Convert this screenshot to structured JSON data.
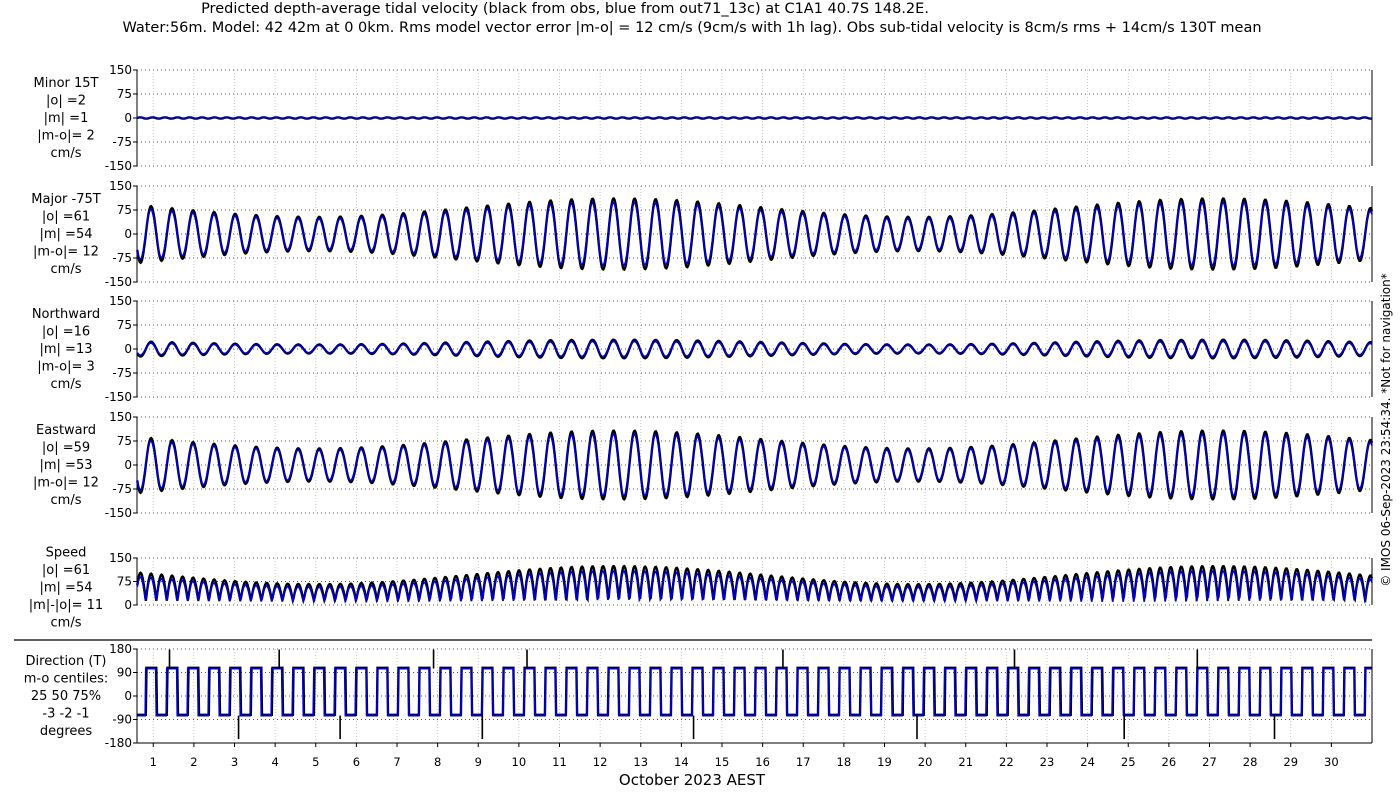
{
  "title": {
    "line1": "Predicted depth-average tidal velocity (black from obs, blue from out71_13c) at C1A1 40.7S 148.2E.",
    "line2": "Water:56m. Model: 42 42m at 0 0km. Rms model vector error |m-o| = 12 cm/s (9cm/s with 1h lag). Obs sub-tidal velocity is 8cm/s rms + 14cm/s 130T mean"
  },
  "side_note": "© IMOS 06-Sep-2023 23:54:34. *Not for navigation*",
  "colors": {
    "obs": "#000000",
    "model": "#0000cc",
    "grid": "#bdbdbd"
  },
  "chart_data": {
    "type": "line",
    "xlabel": "October 2023 AEST",
    "x_ticks": [
      "1",
      "2",
      "3",
      "4",
      "5",
      "6",
      "7",
      "8",
      "9",
      "10",
      "11",
      "12",
      "13",
      "14",
      "15",
      "16",
      "17",
      "18",
      "19",
      "20",
      "21",
      "22",
      "23",
      "24",
      "25",
      "26",
      "27",
      "28",
      "29",
      "30"
    ],
    "x_range_days": [
      0.6,
      31.0
    ],
    "legend": "none",
    "grid": true,
    "panels": [
      {
        "id": "minor",
        "labels": [
          "Minor 15T",
          "|o| =2",
          "|m| =1",
          "|m-o|= 2",
          "cm/s"
        ],
        "ylim": [
          -150,
          150
        ],
        "yticks": [
          "150",
          "75",
          "0",
          "-75",
          "-150"
        ],
        "series": [
          {
            "source": "obs",
            "amplitude": 2
          },
          {
            "source": "model",
            "amplitude": 1
          }
        ]
      },
      {
        "id": "major",
        "labels": [
          "Major -75T",
          "|o| =61",
          "|m| =54",
          "|m-o|= 12",
          "cm/s"
        ],
        "ylim": [
          -150,
          150
        ],
        "yticks": [
          "150",
          "75",
          "0",
          "-75",
          "-150"
        ],
        "series": [
          {
            "source": "obs",
            "amplitude": 61
          },
          {
            "source": "model",
            "amplitude": 54
          }
        ]
      },
      {
        "id": "north",
        "labels": [
          "Northward",
          "|o| =16",
          "|m| =13",
          "|m-o|= 3",
          "cm/s"
        ],
        "ylim": [
          -150,
          150
        ],
        "yticks": [
          "150",
          "75",
          "0",
          "-75",
          "-150"
        ],
        "series": [
          {
            "source": "obs",
            "amplitude": 16
          },
          {
            "source": "model",
            "amplitude": 13
          }
        ]
      },
      {
        "id": "east",
        "labels": [
          "Eastward",
          "|o| =59",
          "|m| =53",
          "|m-o|= 12",
          "cm/s"
        ],
        "ylim": [
          -150,
          150
        ],
        "yticks": [
          "150",
          "75",
          "0",
          "-75",
          "-150"
        ],
        "series": [
          {
            "source": "obs",
            "amplitude": 59
          },
          {
            "source": "model",
            "amplitude": 53
          }
        ]
      },
      {
        "id": "speed",
        "labels": [
          "Speed",
          "|o| =61",
          "|m| =54",
          "|m|-|o|= 11",
          "cm/s"
        ],
        "ylim": [
          0,
          150
        ],
        "yticks": [
          "150",
          "75",
          "0"
        ],
        "series": [
          {
            "source": "obs",
            "amplitude": 61
          },
          {
            "source": "model",
            "amplitude": 54
          }
        ]
      },
      {
        "id": "direction",
        "labels": [
          "Direction (T)",
          "m-o centiles:",
          "25  50  75%",
          "-3 -2 -1",
          "degrees"
        ],
        "ylim": [
          -180,
          180
        ],
        "yticks": [
          "180",
          "90",
          "0",
          "-90",
          "-180"
        ],
        "series": [
          {
            "source": "obs",
            "levels": [
              105,
              -75
            ]
          },
          {
            "source": "model",
            "levels": [
              105,
              -75
            ]
          }
        ]
      }
    ]
  }
}
